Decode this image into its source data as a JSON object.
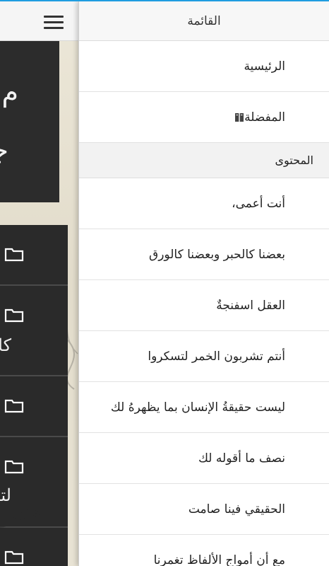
{
  "drawer": {
    "title": "القائمة",
    "nav": [
      {
        "label": "الرئيسية"
      },
      {
        "label": "المفضلة",
        "icon": "book-icon"
      }
    ],
    "section_title": "المحتوى",
    "content_items": [
      {
        "label": "أنت أعمى،"
      },
      {
        "label": "بعضنا كالحبر وبعضنا كالورق"
      },
      {
        "label": "العقل اسفنجةٌ"
      },
      {
        "label": "أنتم تشربون الخمر لتسكروا"
      },
      {
        "label": "ليست حقيقةُ الإنسان بما يظهرهُ لك"
      },
      {
        "label": "نصف ما أقوله لك"
      },
      {
        "label": "الحقيقي فينا صامت"
      },
      {
        "label": "مع أن أمواج الألفاظ تغمرنا"
      }
    ]
  },
  "background": {
    "hero_line1": "م",
    "hero_line2": "جبر",
    "card2_text": "كالو",
    "card4_text": "لتس",
    "watermark": "جبرا"
  },
  "colors": {
    "accent": "#1f9de0",
    "drawer_bg": "#ffffff",
    "section_bg": "#f2f2f2",
    "dark_card": "#2a2a2a"
  }
}
